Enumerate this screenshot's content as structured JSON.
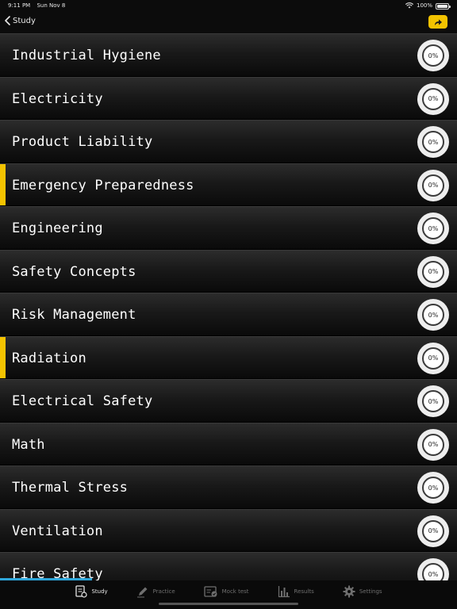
{
  "status_bar": {
    "time": "9:11 PM",
    "date": "Sun Nov 8",
    "battery": "100%"
  },
  "nav": {
    "back_label": "Study"
  },
  "topics": [
    {
      "title": "Industrial Hygiene",
      "progress": "0%",
      "highlighted": false
    },
    {
      "title": "Electricity",
      "progress": "0%",
      "highlighted": false
    },
    {
      "title": "Product Liability",
      "progress": "0%",
      "highlighted": false
    },
    {
      "title": "Emergency Preparedness",
      "progress": "0%",
      "highlighted": true
    },
    {
      "title": "Engineering",
      "progress": "0%",
      "highlighted": false
    },
    {
      "title": "Safety Concepts",
      "progress": "0%",
      "highlighted": false
    },
    {
      "title": "Risk Management",
      "progress": "0%",
      "highlighted": false
    },
    {
      "title": "Radiation",
      "progress": "0%",
      "highlighted": true
    },
    {
      "title": "Electrical Safety",
      "progress": "0%",
      "highlighted": false
    },
    {
      "title": "Math",
      "progress": "0%",
      "highlighted": false
    },
    {
      "title": "Thermal Stress",
      "progress": "0%",
      "highlighted": false
    },
    {
      "title": "Ventilation",
      "progress": "0%",
      "highlighted": false
    },
    {
      "title": "Fire Safety",
      "progress": "0%",
      "highlighted": false
    }
  ],
  "tabs": [
    {
      "label": "Study",
      "icon": "study-icon",
      "active": true
    },
    {
      "label": "Practice",
      "icon": "pencil-icon",
      "active": false
    },
    {
      "label": "Mock test",
      "icon": "mock-test-icon",
      "active": false
    },
    {
      "label": "Results",
      "icon": "bar-chart-icon",
      "active": false
    },
    {
      "label": "Settings",
      "icon": "gear-icon",
      "active": false
    }
  ],
  "colors": {
    "accent": "#f4c300",
    "scroll_indicator": "#2fa6d9"
  }
}
